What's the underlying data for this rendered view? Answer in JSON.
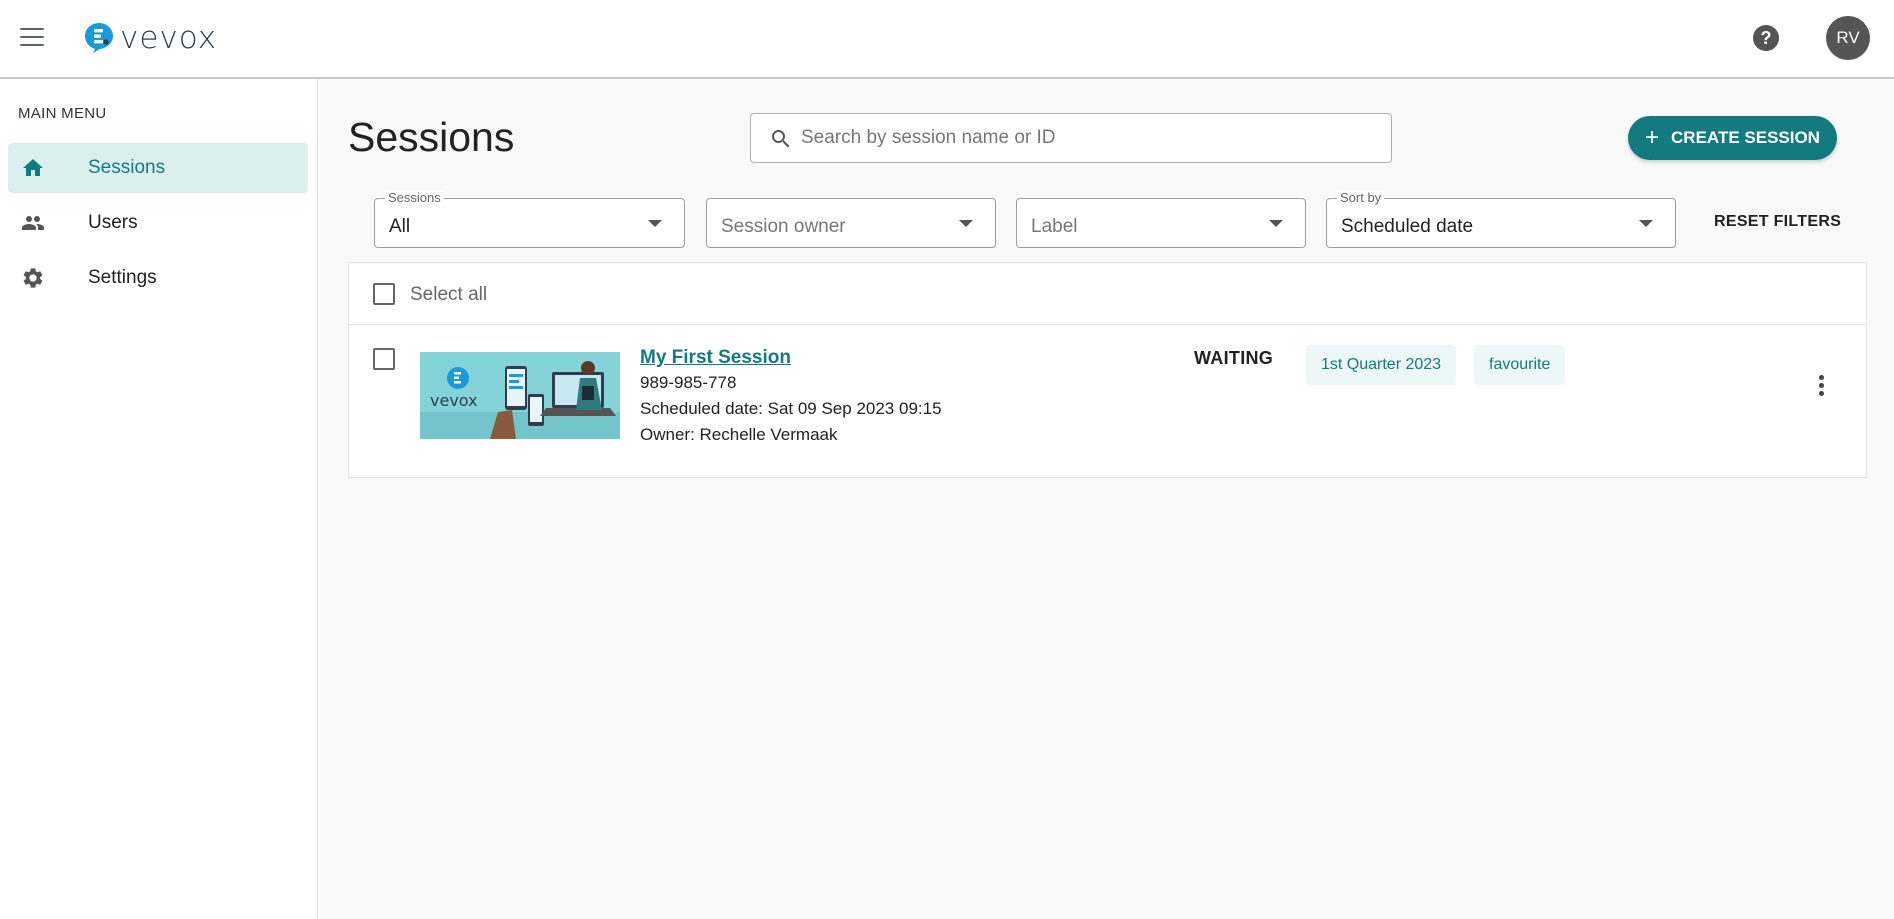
{
  "app": {
    "logo_text": "vevox",
    "avatar_initials": "RV",
    "help_symbol": "?"
  },
  "sidebar": {
    "heading": "MAIN MENU",
    "items": [
      {
        "label": "Sessions",
        "icon": "home-icon",
        "active": true
      },
      {
        "label": "Users",
        "icon": "users-icon",
        "active": false
      },
      {
        "label": "Settings",
        "icon": "gear-icon",
        "active": false
      }
    ]
  },
  "main": {
    "title": "Sessions",
    "search_placeholder": "Search by session name or ID",
    "create_button": "CREATE SESSION",
    "reset_filters": "RESET FILTERS",
    "filters": {
      "sessions": {
        "label": "Sessions",
        "value": "All"
      },
      "owner": {
        "placeholder": "Session owner"
      },
      "label": {
        "placeholder": "Label"
      },
      "sort": {
        "label": "Sort by",
        "value": "Scheduled date"
      }
    },
    "select_all": "Select all"
  },
  "sessions": [
    {
      "title": "My First Session",
      "id": "989-985-778",
      "scheduled": "Scheduled date: Sat 09 Sep 2023 09:15",
      "owner": "Owner: Rechelle Vermaak",
      "status": "WAITING",
      "tags": [
        "1st Quarter 2023",
        "favourite"
      ],
      "thumbnail_text": "vevox"
    }
  ],
  "colors": {
    "accent": "#137a80",
    "active_nav_bg": "#dcefef",
    "tag_bg": "#ecf7f8",
    "logo_blue": "#1a9ad6"
  }
}
